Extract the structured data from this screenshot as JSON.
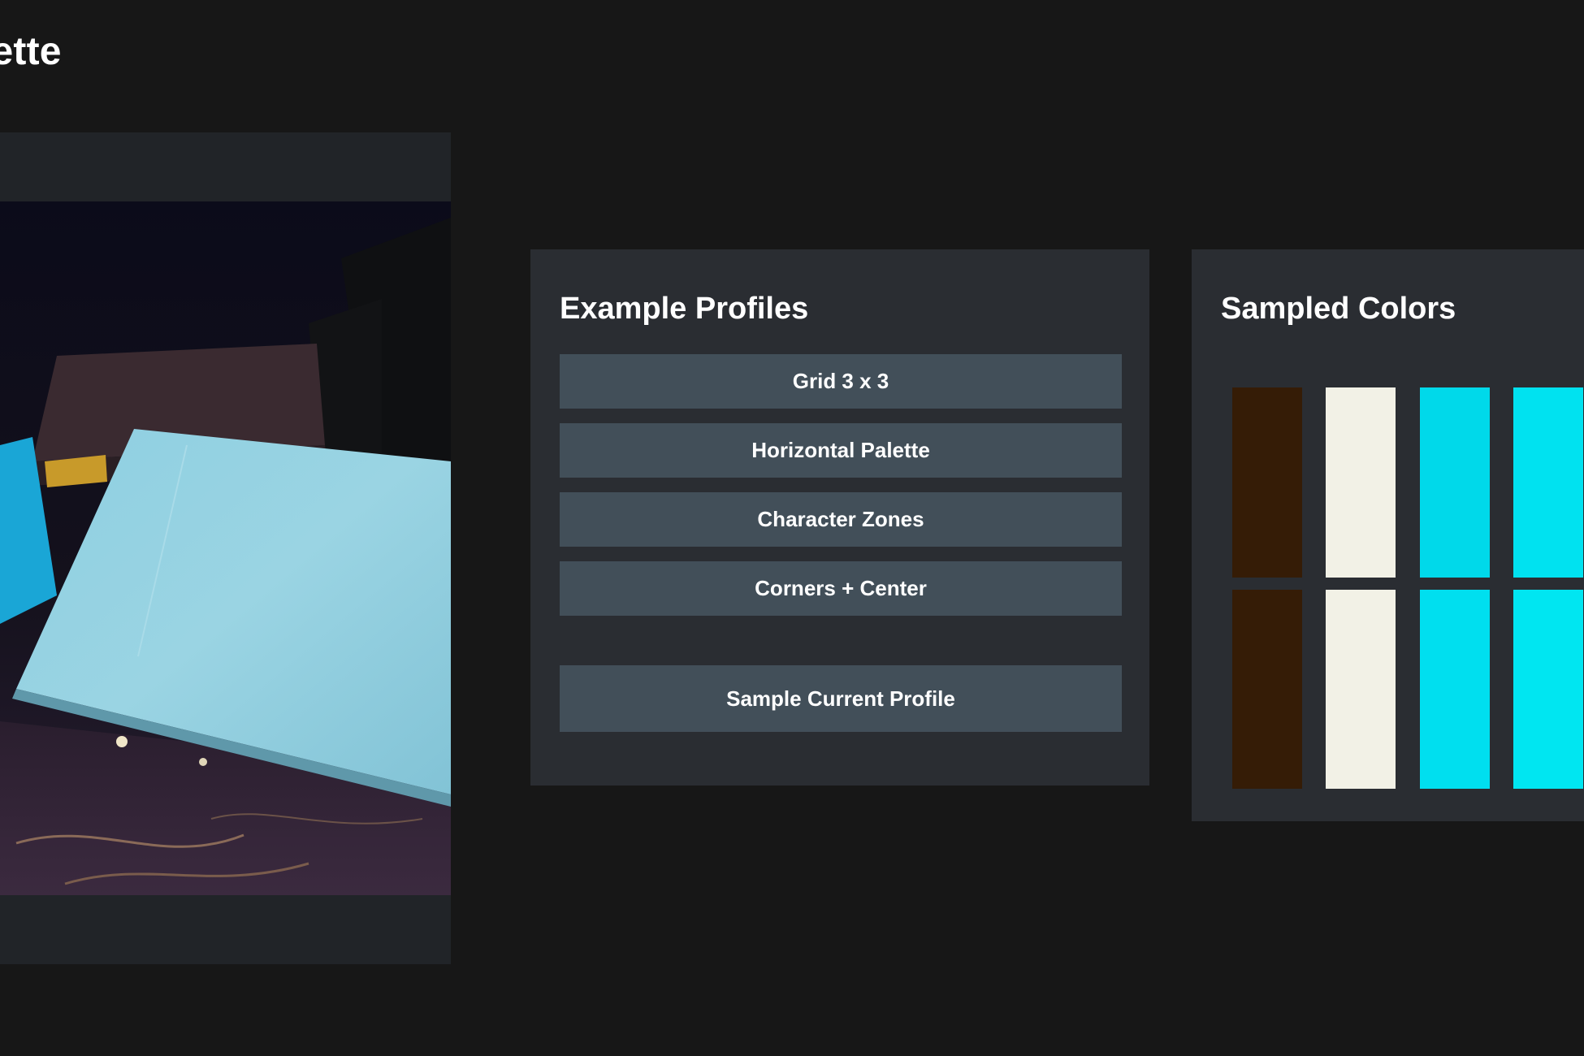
{
  "app": {
    "title_visible": "lette"
  },
  "camera": {
    "label": ""
  },
  "profiles": {
    "heading": "Example Profiles",
    "buttons": [
      "Grid 3 x 3",
      "Horizontal Palette",
      "Character Zones",
      "Corners + Center"
    ],
    "sample_button": "Sample Current Profile"
  },
  "sampled_colors": {
    "heading": "Sampled Colors",
    "rows": [
      [
        "#351c06",
        "#f2f1e6",
        "#00d9ea",
        "#00e2f0"
      ],
      [
        "#351c06",
        "#f2f1e6",
        "#00dfef",
        "#00e6f1"
      ]
    ]
  }
}
